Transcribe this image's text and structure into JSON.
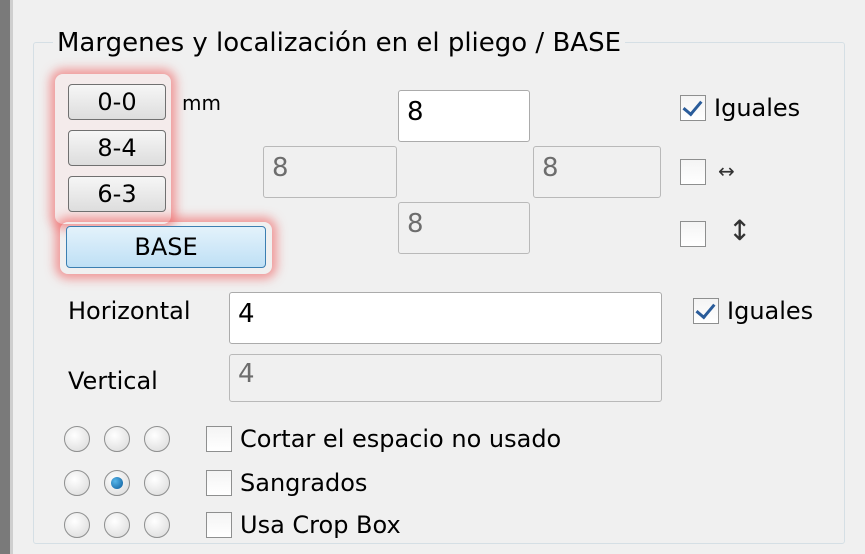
{
  "group": {
    "title": "Margenes y localización en el pliego / BASE"
  },
  "presets": {
    "p00": "0-0",
    "p84": "8-4",
    "p63": "6-3",
    "base": "BASE",
    "unit": "mm"
  },
  "margins": {
    "top": "8",
    "left": "8",
    "right": "8",
    "bottom": "8",
    "equal_label": "Iguales",
    "equal_checked": true,
    "horizontal_link_checked": false,
    "vertical_link_checked": false,
    "horizontal_icon": "horizontal-arrows-icon",
    "vertical_icon": "vertical-arrows-icon"
  },
  "spacing": {
    "horizontal_label": "Horizontal",
    "horizontal_value": "4",
    "vertical_label": "Vertical",
    "vertical_value": "4",
    "equal_label": "Iguales",
    "equal_checked": true
  },
  "alignment": {
    "selected": "middle-center"
  },
  "options": {
    "cut_unused": "Cortar el espacio no usado",
    "bleeds": "Sangrados",
    "crop_box": "Usa Crop Box"
  }
}
